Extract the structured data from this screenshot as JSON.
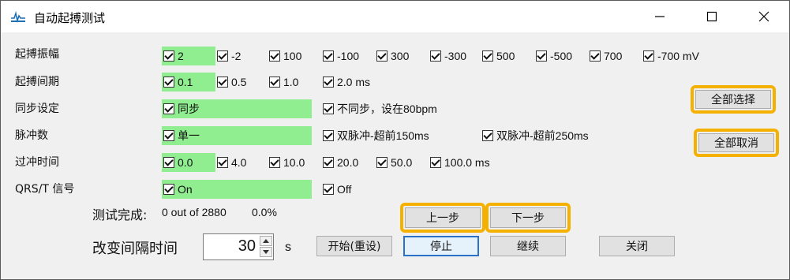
{
  "window": {
    "title": "自动起搏测试"
  },
  "rows": [
    {
      "label": "起搏振幅",
      "options": [
        "2",
        "-2",
        "100",
        "-100",
        "300",
        "-300",
        "500",
        "-500",
        "700",
        "-700 mV"
      ]
    },
    {
      "label": "起搏间期",
      "options": [
        "0.1",
        "0.5",
        "1.0",
        "2.0 ms"
      ]
    },
    {
      "label": "同步设定",
      "options": [
        "同步",
        "不同步，设在80bpm"
      ]
    },
    {
      "label": "脉冲数",
      "options": [
        "单一",
        "双脉冲-超前150ms",
        "双脉冲-超前250ms"
      ]
    },
    {
      "label": "过冲时间",
      "options": [
        "0.0",
        "4.0",
        "10.0",
        "20.0",
        "50.0",
        "100.0 ms"
      ]
    },
    {
      "label": "QRS/T 信号",
      "options": [
        "On",
        "Off"
      ]
    }
  ],
  "buttons": {
    "select_all": "全部选择",
    "deselect_all": "全部取消",
    "prev": "上一步",
    "next": "下一步",
    "start": "开始(重设)",
    "stop": "停止",
    "continue": "继续",
    "close": "关闭"
  },
  "status": {
    "label": "测试完成:",
    "progress": "0 out of 2880",
    "percent": "0.0%"
  },
  "interval": {
    "label": "改变间隔时间",
    "value": "30",
    "unit": "s"
  },
  "colors": {
    "selected": "#90ee90",
    "highlight": "#f5b100",
    "default_button_border": "#2a72c8"
  }
}
